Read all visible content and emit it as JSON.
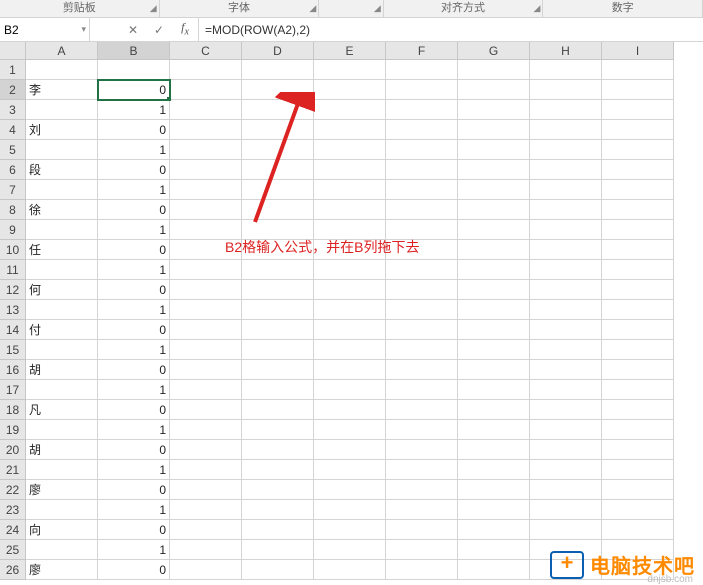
{
  "ribbon_groups": [
    "剪贴板",
    "字体",
    "",
    "对齐方式",
    "数字"
  ],
  "name_box": "B2",
  "formula": "=MOD(ROW(A2),2)",
  "columns": [
    "A",
    "B",
    "C",
    "D",
    "E",
    "F",
    "G",
    "H",
    "I"
  ],
  "selected_col": "B",
  "selected_row": 2,
  "rows": [
    {
      "n": 1,
      "a": "",
      "b": ""
    },
    {
      "n": 2,
      "a": "李",
      "b": "0"
    },
    {
      "n": 3,
      "a": "",
      "b": "1"
    },
    {
      "n": 4,
      "a": "刘",
      "b": "0"
    },
    {
      "n": 5,
      "a": "",
      "b": "1"
    },
    {
      "n": 6,
      "a": "段",
      "b": "0"
    },
    {
      "n": 7,
      "a": "",
      "b": "1"
    },
    {
      "n": 8,
      "a": "徐",
      "b": "0"
    },
    {
      "n": 9,
      "a": "",
      "b": "1"
    },
    {
      "n": 10,
      "a": "任",
      "b": "0"
    },
    {
      "n": 11,
      "a": "",
      "b": "1"
    },
    {
      "n": 12,
      "a": "何",
      "b": "0"
    },
    {
      "n": 13,
      "a": "",
      "b": "1"
    },
    {
      "n": 14,
      "a": "付",
      "b": "0"
    },
    {
      "n": 15,
      "a": "",
      "b": "1"
    },
    {
      "n": 16,
      "a": "胡",
      "b": "0"
    },
    {
      "n": 17,
      "a": "",
      "b": "1"
    },
    {
      "n": 18,
      "a": "凡",
      "b": "0"
    },
    {
      "n": 19,
      "a": "",
      "b": "1"
    },
    {
      "n": 20,
      "a": "胡",
      "b": "0"
    },
    {
      "n": 21,
      "a": "",
      "b": "1"
    },
    {
      "n": 22,
      "a": "廖",
      "b": "0"
    },
    {
      "n": 23,
      "a": "",
      "b": "1"
    },
    {
      "n": 24,
      "a": "向",
      "b": "0"
    },
    {
      "n": 25,
      "a": "",
      "b": "1"
    },
    {
      "n": 26,
      "a": "廖",
      "b": "0"
    }
  ],
  "annotation_text": "B2格输入公式，并在B列拖下去",
  "watermark": {
    "text": "电脑技术吧",
    "sub": "dnjsb.com"
  }
}
